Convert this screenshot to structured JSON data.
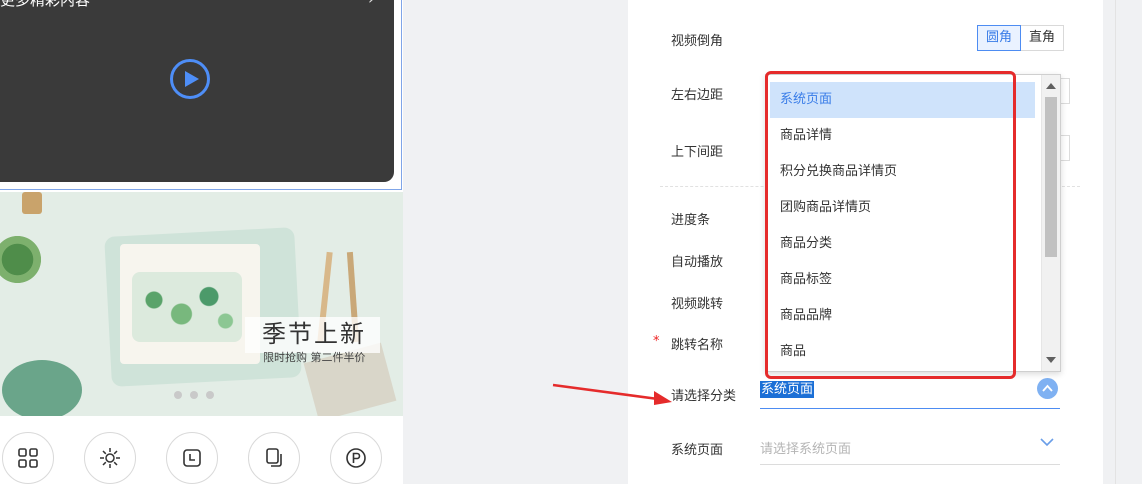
{
  "preview": {
    "video_title": "更多精彩内容",
    "banner_title": "季节上新",
    "banner_subtitle": "限时抢购 第二件半价"
  },
  "settings": {
    "video_corner_label": "视频倒角",
    "corner_options": [
      "圆角",
      "直角"
    ],
    "corner_selected": "圆角",
    "lr_margin_label": "左右边距",
    "tb_spacing_label": "上下间距",
    "progress_label": "进度条",
    "autoplay_label": "自动播放",
    "video_jump_label": "视频跳转",
    "jump_name_label": "跳转名称",
    "required_mark": "*",
    "category_label": "请选择分类",
    "category_value": "系统页面",
    "system_page_label": "系统页面",
    "system_page_placeholder": "请选择系统页面"
  },
  "dropdown": {
    "options": [
      "系统页面",
      "商品详情",
      "积分兑换商品详情页",
      "团购商品详情页",
      "商品分类",
      "商品标签",
      "商品品牌",
      "商品"
    ],
    "selected": "系统页面"
  },
  "colors": {
    "accent": "#4d8cf2",
    "annotation_red": "#e52b2b",
    "selected_bg": "#cfe3fb"
  },
  "icons": [
    "grid-icon",
    "sun-icon",
    "clock-icon",
    "copy-icon",
    "points-icon",
    "play-icon",
    "chevron-up-icon",
    "chevron-down-icon"
  ]
}
